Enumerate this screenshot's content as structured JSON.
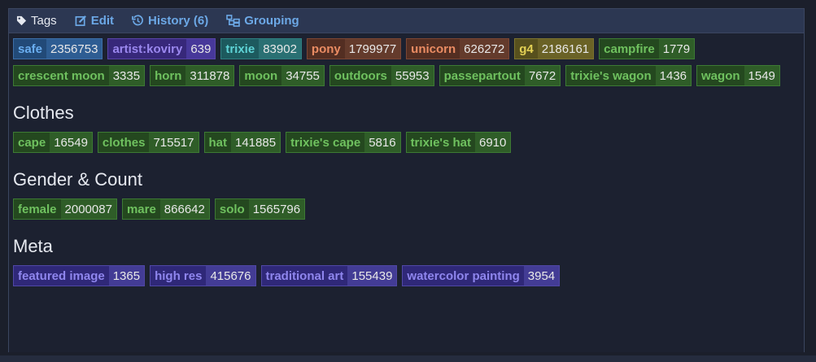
{
  "header": {
    "title": "Tags",
    "edit_label": "Edit",
    "history_label": "History (6)",
    "grouping_label": "Grouping"
  },
  "general_tags": [
    {
      "name": "safe",
      "count": "2356753",
      "color": "blue"
    },
    {
      "name": "artist:koviry",
      "count": "639",
      "color": "purple"
    },
    {
      "name": "trixie",
      "count": "83902",
      "color": "teal"
    },
    {
      "name": "pony",
      "count": "1799977",
      "color": "orange"
    },
    {
      "name": "unicorn",
      "count": "626272",
      "color": "orange"
    },
    {
      "name": "g4",
      "count": "2186161",
      "color": "yellow"
    },
    {
      "name": "campfire",
      "count": "1779",
      "color": "green"
    },
    {
      "name": "crescent moon",
      "count": "3335",
      "color": "green"
    },
    {
      "name": "horn",
      "count": "311878",
      "color": "green"
    },
    {
      "name": "moon",
      "count": "34755",
      "color": "green"
    },
    {
      "name": "outdoors",
      "count": "55953",
      "color": "green"
    },
    {
      "name": "passepartout",
      "count": "7672",
      "color": "green"
    },
    {
      "name": "trixie's wagon",
      "count": "1436",
      "color": "green"
    },
    {
      "name": "wagon",
      "count": "1549",
      "color": "green"
    }
  ],
  "sections": [
    {
      "title": "Clothes",
      "tags": [
        {
          "name": "cape",
          "count": "16549",
          "color": "green"
        },
        {
          "name": "clothes",
          "count": "715517",
          "color": "green"
        },
        {
          "name": "hat",
          "count": "141885",
          "color": "green"
        },
        {
          "name": "trixie's cape",
          "count": "5816",
          "color": "green"
        },
        {
          "name": "trixie's hat",
          "count": "6910",
          "color": "green"
        }
      ]
    },
    {
      "title": "Gender & Count",
      "tags": [
        {
          "name": "female",
          "count": "2000087",
          "color": "green"
        },
        {
          "name": "mare",
          "count": "866642",
          "color": "green"
        },
        {
          "name": "solo",
          "count": "1565796",
          "color": "green"
        }
      ]
    },
    {
      "title": "Meta",
      "tags": [
        {
          "name": "featured image",
          "count": "1365",
          "color": "indigo"
        },
        {
          "name": "high res",
          "count": "415676",
          "color": "indigo"
        },
        {
          "name": "traditional art",
          "count": "155439",
          "color": "indigo"
        },
        {
          "name": "watercolor painting",
          "count": "3954",
          "color": "indigo"
        }
      ]
    }
  ],
  "icons": {
    "title": "tag-icon",
    "edit": "edit-icon",
    "history": "history-icon",
    "grouping": "grouping-icon"
  }
}
